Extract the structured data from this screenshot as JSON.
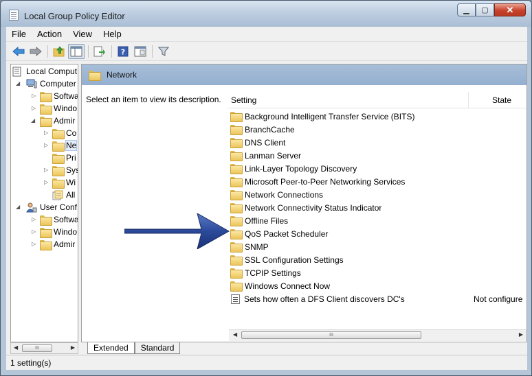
{
  "window": {
    "title": "Local Group Policy Editor"
  },
  "menu": [
    "File",
    "Action",
    "View",
    "Help"
  ],
  "tree": [
    {
      "label": "Local Comput",
      "icon": "policy-doc-icon"
    },
    {
      "label": "Computer",
      "icon": "computer-icon"
    },
    {
      "label": "Softwa",
      "icon": "folder-icon"
    },
    {
      "label": "Windo",
      "icon": "folder-icon"
    },
    {
      "label": "Admir",
      "icon": "folder-icon"
    },
    {
      "label": "Co",
      "icon": "folder-icon"
    },
    {
      "label": "Ne",
      "icon": "folder-icon"
    },
    {
      "label": "Pri",
      "icon": "folder-icon"
    },
    {
      "label": "Sys",
      "icon": "folder-icon"
    },
    {
      "label": "Wi",
      "icon": "folder-icon"
    },
    {
      "label": "All",
      "icon": "all-settings-icon"
    },
    {
      "label": "User Conf",
      "icon": "user-icon"
    },
    {
      "label": "Softwa",
      "icon": "folder-icon"
    },
    {
      "label": "Windo",
      "icon": "folder-icon"
    },
    {
      "label": "Admir",
      "icon": "folder-icon"
    }
  ],
  "pane": {
    "title": "Network",
    "description": "Select an item to view its description.",
    "col_setting": "Setting",
    "col_state": "State"
  },
  "rows": [
    {
      "name": "Background Intelligent Transfer Service (BITS)",
      "state": ""
    },
    {
      "name": "BranchCache",
      "state": ""
    },
    {
      "name": "DNS Client",
      "state": ""
    },
    {
      "name": "Lanman Server",
      "state": ""
    },
    {
      "name": "Link-Layer Topology Discovery",
      "state": ""
    },
    {
      "name": "Microsoft Peer-to-Peer Networking Services",
      "state": ""
    },
    {
      "name": "Network Connections",
      "state": ""
    },
    {
      "name": "Network Connectivity Status Indicator",
      "state": ""
    },
    {
      "name": "Offline Files",
      "state": ""
    },
    {
      "name": "QoS Packet Scheduler",
      "state": ""
    },
    {
      "name": "SNMP",
      "state": ""
    },
    {
      "name": "SSL Configuration Settings",
      "state": ""
    },
    {
      "name": "TCPIP Settings",
      "state": ""
    },
    {
      "name": "Windows Connect Now",
      "state": ""
    },
    {
      "name": "Sets how often a DFS Client discovers DC's",
      "state": "Not configure"
    }
  ],
  "tabs": {
    "extended": "Extended",
    "standard": "Standard"
  },
  "status": {
    "text": "1 setting(s)"
  },
  "colors": {
    "header_blue": "#9fb8d5",
    "arrow_blue": "#2b4a9a"
  }
}
